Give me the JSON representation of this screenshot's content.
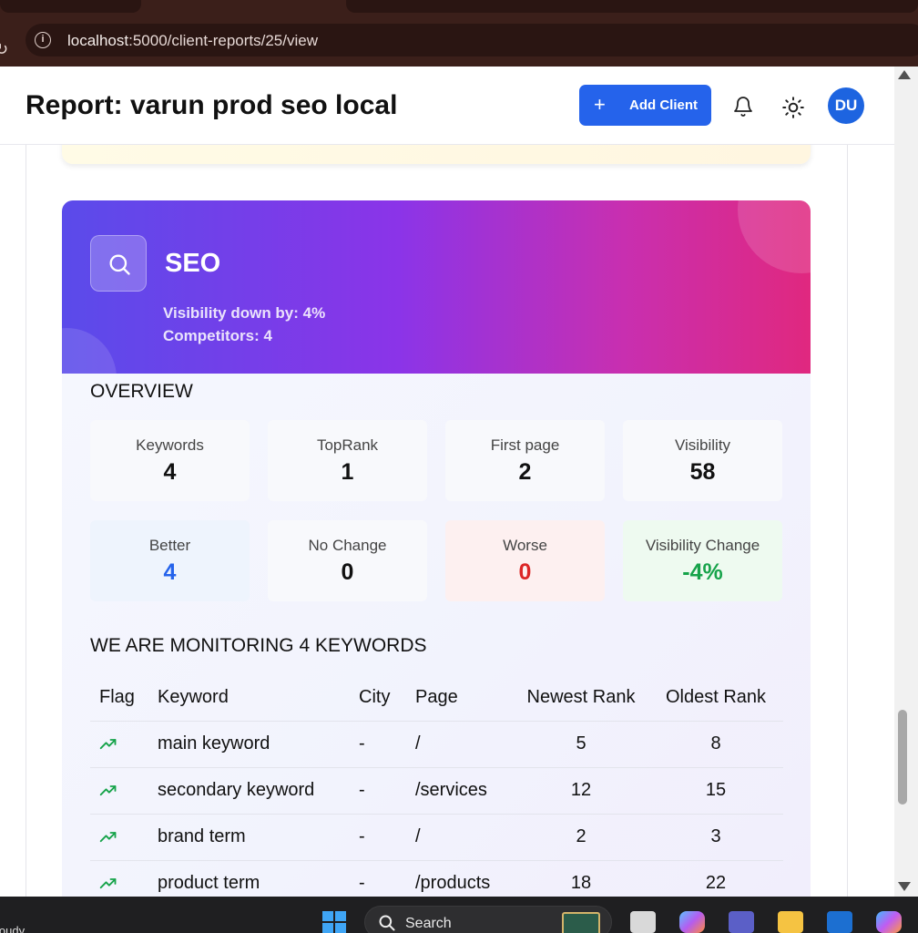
{
  "browser": {
    "url_host": "localhost",
    "url_rest": ":5000/client-reports/25/view"
  },
  "header": {
    "title": "Report: varun prod seo local",
    "add_client_label": "Add Client",
    "avatar_initials": "DU"
  },
  "seo": {
    "title": "SEO",
    "visibility_line": "Visibility down by: 4%",
    "competitors_line": "Competitors: 4",
    "overview_heading": "OVERVIEW",
    "stats": [
      {
        "label": "Keywords",
        "value": "4"
      },
      {
        "label": "TopRank",
        "value": "1"
      },
      {
        "label": "First page",
        "value": "2"
      },
      {
        "label": "Visibility",
        "value": "58"
      },
      {
        "label": "Better",
        "value": "4"
      },
      {
        "label": "No Change",
        "value": "0"
      },
      {
        "label": "Worse",
        "value": "0"
      },
      {
        "label": "Visibility Change",
        "value": "-4%"
      }
    ],
    "monitor_heading": "WE ARE MONITORING 4 KEYWORDS",
    "table": {
      "columns": [
        "Flag",
        "Keyword",
        "City",
        "Page",
        "Newest Rank",
        "Oldest Rank"
      ],
      "rows": [
        {
          "flag": "trending-up",
          "keyword": "main keyword",
          "city": "-",
          "page": "/",
          "newest": "5",
          "oldest": "8"
        },
        {
          "flag": "trending-up",
          "keyword": "secondary keyword",
          "city": "-",
          "page": "/services",
          "newest": "12",
          "oldest": "15"
        },
        {
          "flag": "trending-up",
          "keyword": "brand term",
          "city": "-",
          "page": "/",
          "newest": "2",
          "oldest": "3"
        },
        {
          "flag": "trending-up",
          "keyword": "product term",
          "city": "-",
          "page": "/products",
          "newest": "18",
          "oldest": "22"
        }
      ]
    }
  },
  "taskbar": {
    "weather_text": "loudy",
    "search_label": "Search"
  },
  "colors": {
    "primary": "#2563eb",
    "better": "#2563eb",
    "worse": "#dc2626",
    "positive": "#16a34a",
    "hero_gradient_start": "#5a4bea",
    "hero_gradient_end": "#e0287f"
  }
}
